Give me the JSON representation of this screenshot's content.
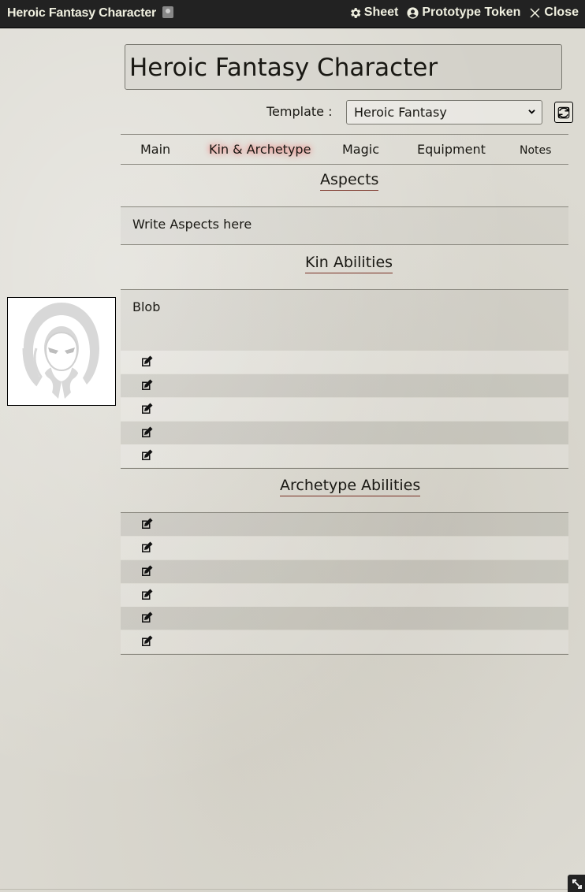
{
  "window": {
    "title": "Heroic Fantasy Character",
    "buttons": {
      "sheet": "Sheet",
      "prototype_token": "Prototype Token",
      "close": "Close"
    }
  },
  "character": {
    "name": "Heroic Fantasy Character"
  },
  "template": {
    "label": "Template :",
    "selected": "Heroic Fantasy"
  },
  "tabs": [
    "Main",
    "Kin & Archetype",
    "Magic",
    "Equipment",
    "Notes"
  ],
  "active_tab": "Kin & Archetype",
  "aspects": {
    "heading": "Aspects",
    "text": "Write Aspects here"
  },
  "kin_abilities": {
    "heading": "Kin Abilities",
    "kin": "Blob",
    "ability_rows": 5
  },
  "archetype_abilities": {
    "heading": "Archetype Abilities",
    "ability_rows": 6
  },
  "colors": {
    "titlebar": "#222222",
    "accent_underline": "#782e22",
    "active_tab_glow": "#ff4a4a"
  },
  "icons": [
    "book-icon",
    "gear-icon",
    "user-circle-icon",
    "close-icon",
    "chevron-down-icon",
    "refresh-icon",
    "edit-icon",
    "resize-icon",
    "hooded-figure-icon"
  ]
}
